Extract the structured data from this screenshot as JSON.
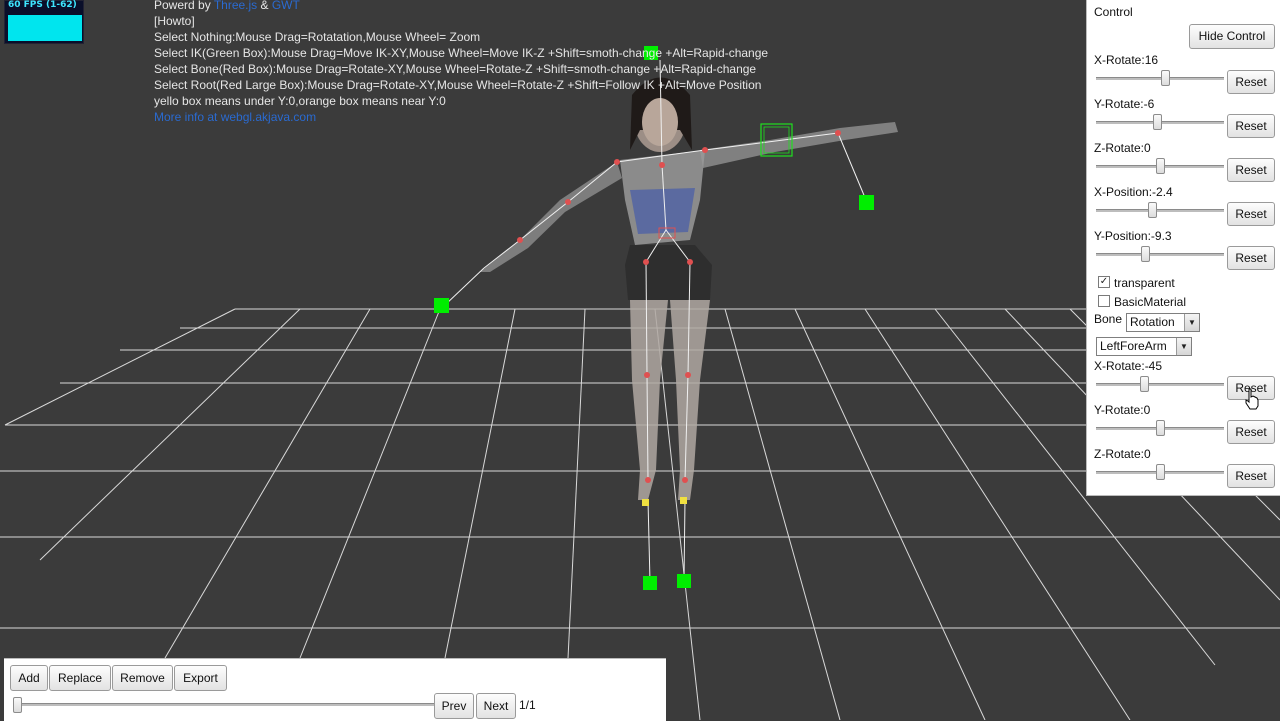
{
  "fps": {
    "label": "60 FPS (1-62)"
  },
  "howto": {
    "powered_prefix": "Powerd by ",
    "powered_link1": "Three.js",
    "powered_amp": " & ",
    "powered_link2": "GWT",
    "title": "[Howto]",
    "line1": "Select Nothing:Mouse Drag=Rotatation,Mouse Wheel= Zoom",
    "line2": "Select IK(Green Box):Mouse Drag=Move IK-XY,Mouse Wheel=Move IK-Z +Shift=smoth-change +Alt=Rapid-change",
    "line3": "Select Bone(Red Box):Mouse Drag=Rotate-XY,Mouse Wheel=Rotate-Z +Shift=smoth-change +Alt=Rapid-change",
    "line4": "Select Root(Red Large Box):Mouse Drag=Rotate-XY,Mouse Wheel=Rotate-Z +Shift=Follow IK +Alt=Move Position",
    "line5": "yello box means under Y:0,orange box means near Y:0",
    "more_link": "More info at webgl.akjava.com"
  },
  "control": {
    "title": "Control",
    "hide_button": "Hide Control",
    "reset_label": "Reset",
    "params": [
      {
        "label": "X-Rotate:16",
        "value": 16,
        "min": -180,
        "max": 180
      },
      {
        "label": "Y-Rotate:-6",
        "value": -6,
        "min": -180,
        "max": 180
      },
      {
        "label": "Z-Rotate:0",
        "value": 0,
        "min": -180,
        "max": 180
      },
      {
        "label": "X-Position:-2.4",
        "value": -2.4,
        "min": -20,
        "max": 20
      },
      {
        "label": "Y-Position:-9.3",
        "value": -9.3,
        "min": -40,
        "max": 40
      }
    ],
    "transparent_label": "transparent",
    "transparent_checked": true,
    "basic_material_label": "BasicMaterial",
    "basic_material_checked": false,
    "bone_label": "Bone",
    "bone_mode": "Rotation",
    "bone_name": "LeftForeArm",
    "bone_params": [
      {
        "label": "X-Rotate:-45",
        "value": -45,
        "min": -180,
        "max": 180
      },
      {
        "label": "Y-Rotate:0",
        "value": 0,
        "min": -180,
        "max": 180
      },
      {
        "label": "Z-Rotate:0",
        "value": 0,
        "min": -180,
        "max": 180
      }
    ]
  },
  "bottom": {
    "add": "Add",
    "replace": "Replace",
    "remove": "Remove",
    "export": "Export",
    "prev": "Prev",
    "next": "Next",
    "page": "1/1",
    "frame_position": 0
  },
  "colors": {
    "background": "#3b3b3b",
    "grid": "#d8d8d8",
    "ik_box": "#00ee00",
    "bone_joint": "#e05050",
    "link": "#2a6ad0"
  }
}
